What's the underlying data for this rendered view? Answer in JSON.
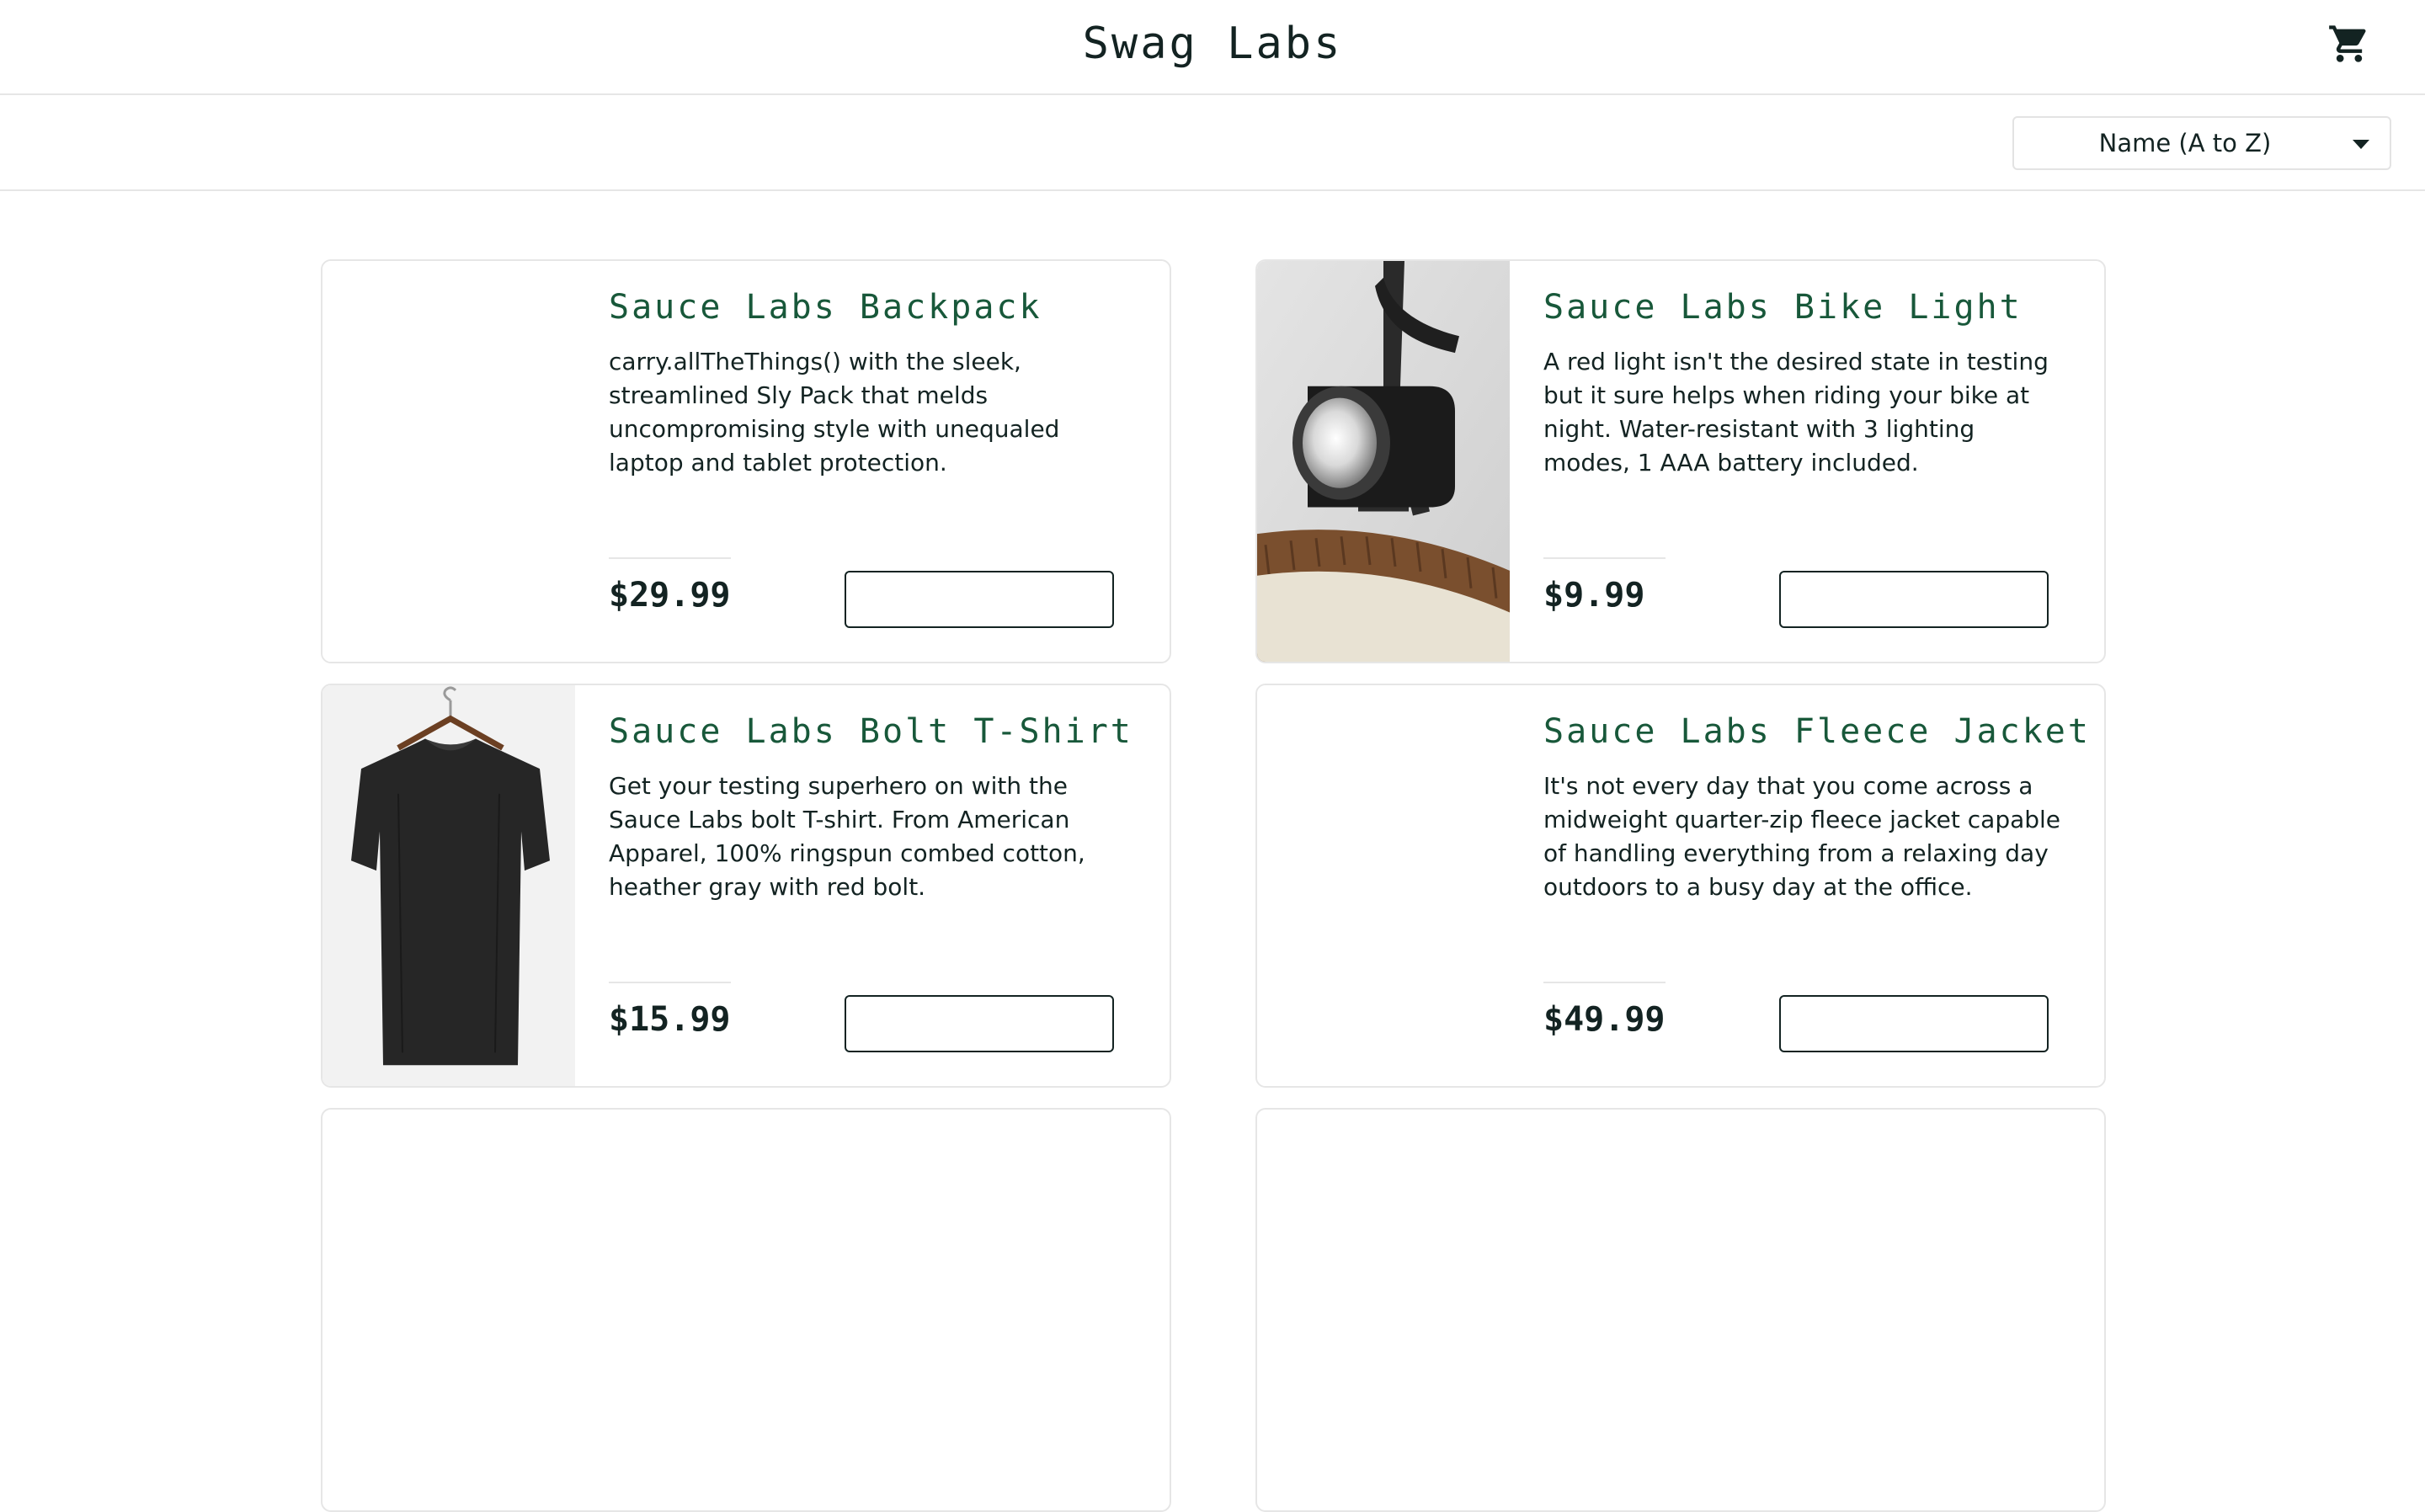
{
  "header": {
    "logo": "Swag Labs",
    "cart_icon": "shopping-cart-icon"
  },
  "sort": {
    "selected": "Name (A to Z)",
    "caret_icon": "caret-down-icon"
  },
  "colors": {
    "product_name": "#18583a",
    "text": "#132322",
    "border": "#e6e6e6"
  },
  "products": [
    {
      "name": "Sauce Labs Backpack",
      "description": "carry.allTheThings() with the sleek, streamlined Sly Pack that melds uncompromising style with unequaled laptop and tablet protection.",
      "price": "$29.99",
      "button_label": "",
      "image": "blank"
    },
    {
      "name": "Sauce Labs Bike Light",
      "description": "A red light isn't the desired state in testing but it sure helps when riding your bike at night. Water-resistant with 3 lighting modes, 1 AAA battery included.",
      "price": "$9.99",
      "button_label": "",
      "image": "bike-light-photo"
    },
    {
      "name": "Sauce Labs Bolt T-Shirt",
      "description": "Get your testing superhero on with the Sauce Labs bolt T-shirt. From American Apparel, 100% ringspun combed cotton, heather gray with red bolt.",
      "price": "$15.99",
      "button_label": "",
      "image": "black-tshirt-photo"
    },
    {
      "name": "Sauce Labs Fleece Jacket",
      "description": "It's not every day that you come across a midweight quarter-zip fleece jacket capable of handling everything from a relaxing day outdoors to a busy day at the office.",
      "price": "$49.99",
      "button_label": "",
      "image": "blank"
    }
  ]
}
